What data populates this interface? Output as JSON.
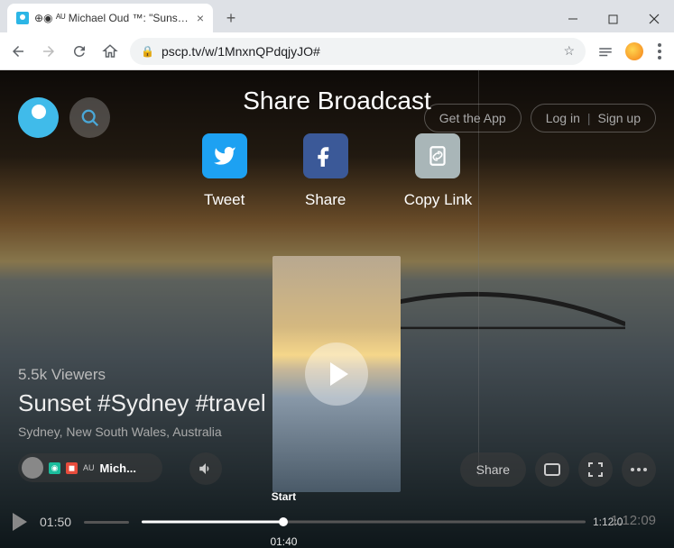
{
  "browser": {
    "tab_title": "⊕◉ ᴬᵁ Michael Oud ™: \"Sunset #",
    "url": "pscp.tv/w/1MnxnQPdqjyJO#"
  },
  "header": {
    "get_app": "Get the App",
    "login": "Log in",
    "signup": "Sign up"
  },
  "share": {
    "title": "Share Broadcast",
    "tweet": "Tweet",
    "facebook": "Share",
    "copy": "Copy Link"
  },
  "broadcast": {
    "viewers": "5.5k Viewers",
    "title": "Sunset #Sydney #travel",
    "location": "Sydney, New South Wales, Australia",
    "user_badge_country": "AU",
    "user_name": "Mich...",
    "share_btn": "Share"
  },
  "player": {
    "current": "01:50",
    "start_label": "Start",
    "start_time": "01:40",
    "end_time": "1:12:0",
    "duration": "1:12:09"
  }
}
